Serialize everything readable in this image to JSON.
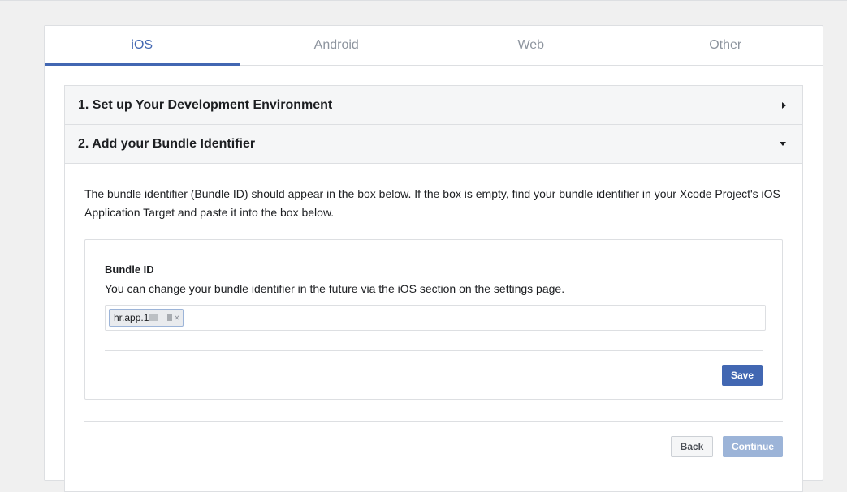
{
  "tabs": [
    {
      "label": "iOS",
      "active": true
    },
    {
      "label": "Android",
      "active": false
    },
    {
      "label": "Web",
      "active": false
    },
    {
      "label": "Other",
      "active": false
    }
  ],
  "steps": [
    {
      "title": "1. Set up Your Development Environment",
      "expanded": false
    },
    {
      "title": "2. Add your Bundle Identifier",
      "expanded": true
    }
  ],
  "step2": {
    "description": "The bundle identifier (Bundle ID) should appear in the box below. If the box is empty, find your bundle identifier in your Xcode Project's iOS Application Target and paste it into the box below.",
    "field_label": "Bundle ID",
    "field_help": "You can change your bundle identifier in the future via the iOS section on the settings page.",
    "token_value": "hr.app.1",
    "token_remove": "×",
    "save_label": "Save"
  },
  "footer": {
    "back_label": "Back",
    "continue_label": "Continue"
  },
  "colors": {
    "accent": "#4267b2",
    "accent_disabled": "#9cb4d8"
  }
}
